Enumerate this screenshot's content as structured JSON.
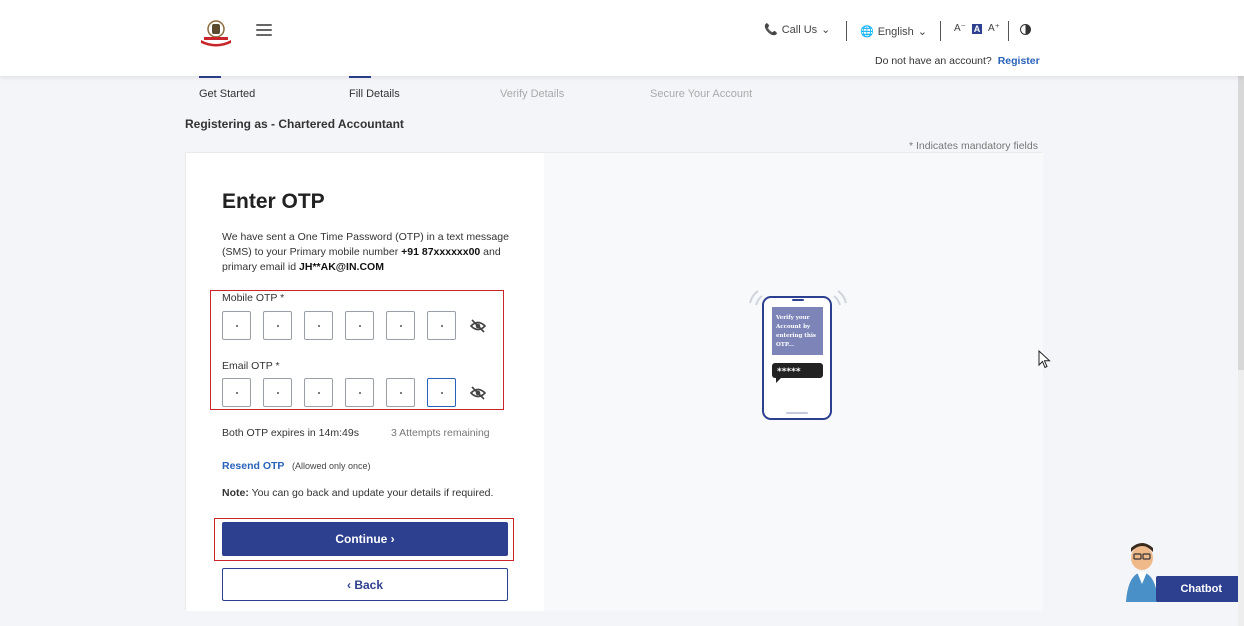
{
  "header": {
    "call_us": "Call Us",
    "language": "English",
    "font_decrease": "A⁻",
    "font_normal": "A",
    "font_increase": "A⁺",
    "no_account_text": "Do not have an account?",
    "register_link": "Register"
  },
  "stepper": {
    "steps": [
      {
        "label": "Get Started",
        "state": "done"
      },
      {
        "label": "Fill Details",
        "state": "done"
      },
      {
        "label": "Verify Details",
        "state": "todo"
      },
      {
        "label": "Secure Your Account",
        "state": "todo"
      }
    ]
  },
  "registering_as": "Registering as - Chartered Accountant",
  "mandatory_note": "* Indicates mandatory fields",
  "form": {
    "title": "Enter OTP",
    "desc_prefix": "We have sent a One Time Password (OTP) in a text message (SMS) to your Primary mobile number ",
    "mobile_number": "+91 87xxxxxx00",
    "desc_middle": " and primary email id ",
    "email": "JH**AK@IN.COM",
    "mobile_otp_label": "Mobile OTP *",
    "email_otp_label": "Email OTP *",
    "expires_text": "Both OTP expires in 14m:49s",
    "attempts_text": "3 Attempts remaining",
    "resend_label": "Resend OTP",
    "resend_note": "(Allowed only once)",
    "note_label": "Note:",
    "note_text": " You can go back and update your details if required.",
    "continue_label": "Continue  ›",
    "back_label": "‹  Back"
  },
  "illustration": {
    "screen_text": "Verify your Account by entering this OTP...",
    "stars": "*****"
  },
  "chatbot_label": "Chatbot",
  "colors": {
    "primary": "#2d3f8f",
    "link": "#2962b8",
    "highlight": "#c9242a"
  }
}
